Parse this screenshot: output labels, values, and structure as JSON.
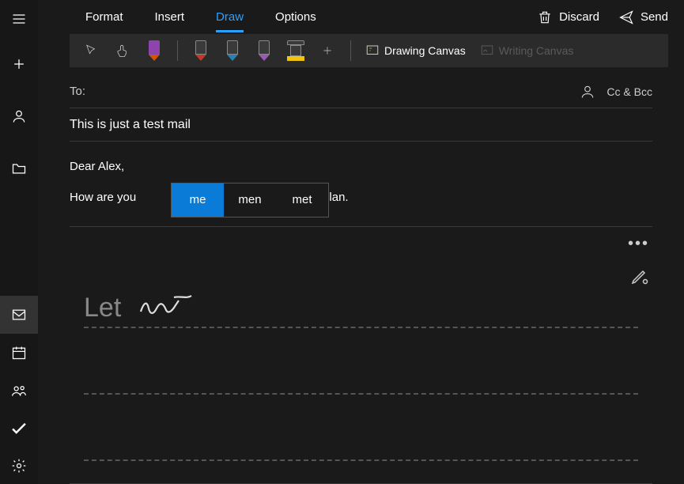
{
  "sidebar": {
    "items": [
      {
        "name": "menu-icon"
      },
      {
        "name": "new-mail-icon"
      },
      {
        "name": "account-icon"
      },
      {
        "name": "folder-icon"
      }
    ],
    "bottom": [
      {
        "name": "mail-icon",
        "active": true
      },
      {
        "name": "calendar-icon"
      },
      {
        "name": "people-icon"
      },
      {
        "name": "todo-icon"
      },
      {
        "name": "settings-icon"
      }
    ]
  },
  "tabs": {
    "items": [
      {
        "label": "Format"
      },
      {
        "label": "Insert"
      },
      {
        "label": "Draw",
        "active": true
      },
      {
        "label": "Options"
      }
    ]
  },
  "actions": {
    "discard": "Discard",
    "send": "Send"
  },
  "ribbon": {
    "drawing_canvas": "Drawing Canvas",
    "writing_canvas": "Writing Canvas",
    "pens": [
      {
        "color": "#8e44ad",
        "tip": "#d35400",
        "name": "pen-purple"
      },
      {
        "color": "#c0392b",
        "tip": "#c0392b",
        "name": "pen-red"
      },
      {
        "color": "#2980b9",
        "tip": "#2980b9",
        "name": "pen-blue"
      },
      {
        "color": "#9b59b6",
        "tip": "#9b59b6",
        "name": "pen-violet"
      }
    ],
    "highlighter": {
      "color": "#f1c40f",
      "name": "highlighter-yellow"
    }
  },
  "fields": {
    "to_label": "To:",
    "ccbcc": "Cc & Bcc",
    "subject": "This is just a test mail"
  },
  "body": {
    "line1": "Dear Alex,",
    "line2_before": "How are you",
    "line2_after": "ess plan."
  },
  "suggestions": {
    "items": [
      "me",
      "men",
      "met"
    ],
    "selected": 0
  },
  "handwriting": {
    "recognized": "Let"
  }
}
